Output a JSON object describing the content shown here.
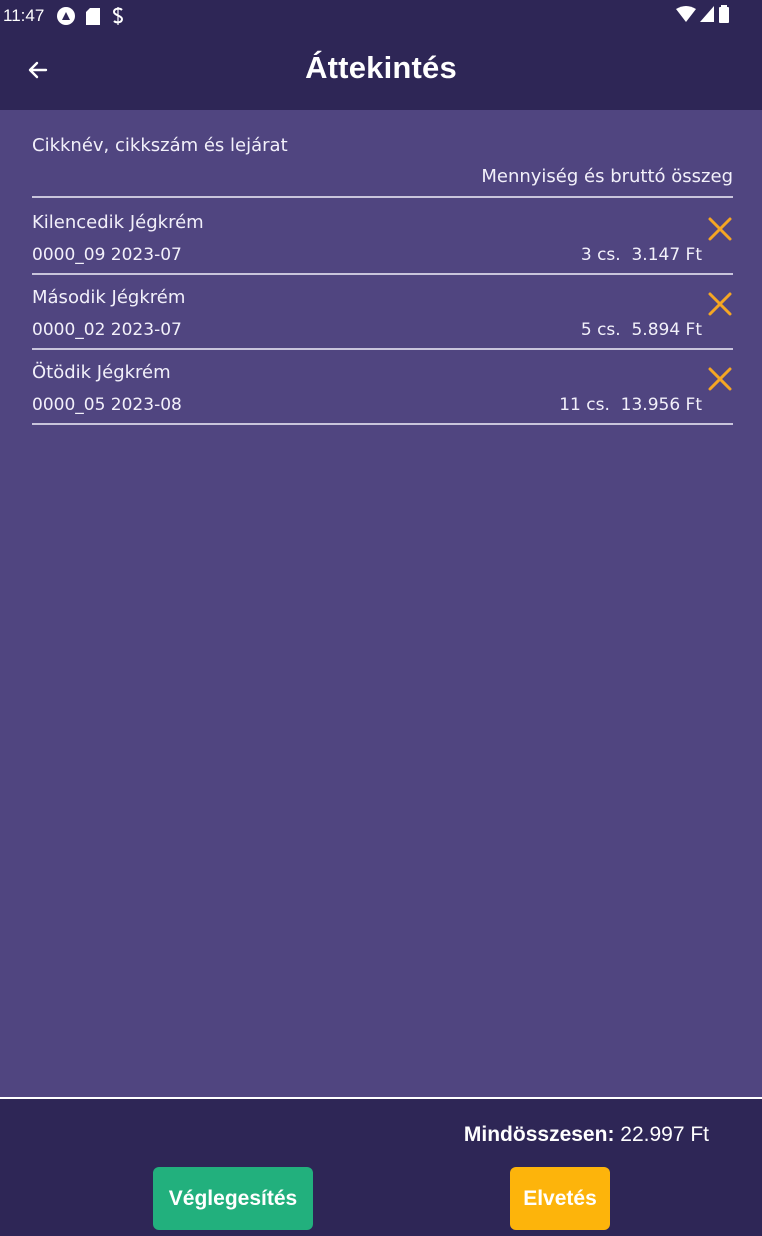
{
  "status_bar": {
    "time": "11:47",
    "icons_left": [
      "assistant-icon",
      "sd-card-icon",
      "sync-icon"
    ],
    "icons_right": [
      "wifi-icon",
      "signal-icon",
      "battery-icon"
    ]
  },
  "app_bar": {
    "title": "Áttekintés",
    "back_icon": "arrow-left-icon"
  },
  "list_header": {
    "left": "Cikknév, cikkszám és lejárat",
    "right": "Mennyiség és bruttó összeg"
  },
  "items": [
    {
      "name": "Kilencedik Jégkrém",
      "code_and_expiry": "0000_09  2023-07",
      "quantity_and_amount": "3 cs.  3.147 Ft"
    },
    {
      "name": "Második Jégkrém",
      "code_and_expiry": "0000_02  2023-07",
      "quantity_and_amount": "5 cs.  5.894 Ft"
    },
    {
      "name": "Ötödik Jégkrém",
      "code_and_expiry": "0000_05  2023-08",
      "quantity_and_amount": "11 cs.  13.956 Ft"
    }
  ],
  "footer": {
    "total_label": "Mindösszesen:",
    "total_value": " 22.997 Ft",
    "confirm_label": "Véglegesítés",
    "discard_label": "Elvetés"
  },
  "colors": {
    "header_bg": "#2e2656",
    "content_bg": "#504580",
    "confirm": "#22b07d",
    "discard": "#fdb40b",
    "delete_icon": "#f5a623"
  }
}
